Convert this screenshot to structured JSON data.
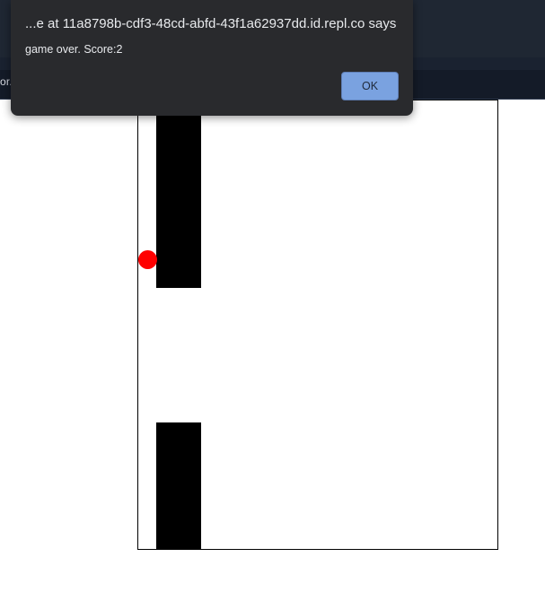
{
  "browser": {
    "bar_text": "or."
  },
  "dialog": {
    "title": "...e at 11a8798b-cdf3-48cd-abfd-43f1a62937dd.id.repl.co says",
    "message": "game over. Score:2",
    "ok_label": "OK",
    "ok_color": "#7aa2e0",
    "background": "#292a2d"
  },
  "game": {
    "score": 2,
    "ball_color": "#ff0000",
    "pipe_color": "#000000"
  }
}
